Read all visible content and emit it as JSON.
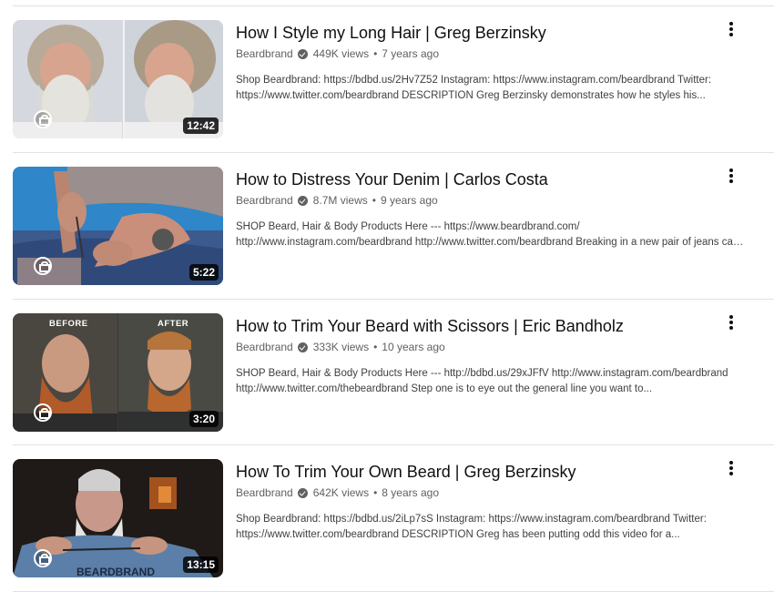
{
  "videos": [
    {
      "title": "How I Style my Long Hair | Greg Berzinsky",
      "channel": "Beardbrand",
      "views": "449K views",
      "age": "7 years ago",
      "desc1": "Shop Beardbrand: https://bdbd.us/2Hv7Z52 Instagram: https://www.instagram.com/beardbrand Twitter:",
      "desc2": "https://www.twitter.com/beardbrand DESCRIPTION Greg Berzinsky demonstrates how he styles his...",
      "duration": "12:42"
    },
    {
      "title": "How to Distress Your Denim | Carlos Costa",
      "channel": "Beardbrand",
      "views": "8.7M views",
      "age": "9 years ago",
      "desc1": "SHOP Beard, Hair & Body Products Here --- https://www.beardbrand.com/",
      "desc2": "http://www.instagram.com/beardbrand http://www.twitter.com/beardbrand Breaking in a new pair of jeans can...",
      "duration": "5:22"
    },
    {
      "title": "How to Trim Your Beard with Scissors | Eric Bandholz",
      "channel": "Beardbrand",
      "views": "333K views",
      "age": "10 years ago",
      "desc1": "SHOP Beard, Hair & Body Products Here --- http://bdbd.us/29xJFfV http://www.instagram.com/beardbrand",
      "desc2": "http://www.twitter.com/thebeardbrand Step one is to eye out the general line you want to...",
      "duration": "3:20",
      "thumb_labels": [
        "BEFORE",
        "AFTER"
      ]
    },
    {
      "title": "How To Trim Your Own Beard | Greg Berzinsky",
      "channel": "Beardbrand",
      "views": "642K views",
      "age": "8 years ago",
      "desc1": "Shop Beardbrand: https://bdbd.us/2iLp7sS Instagram: https://www.instagram.com/beardbrand Twitter:",
      "desc2": "https://www.twitter.com/beardbrand DESCRIPTION Greg has been putting odd this video for a...",
      "duration": "13:15",
      "shirt_text": "BEARDBRAND"
    }
  ],
  "separator": "•"
}
